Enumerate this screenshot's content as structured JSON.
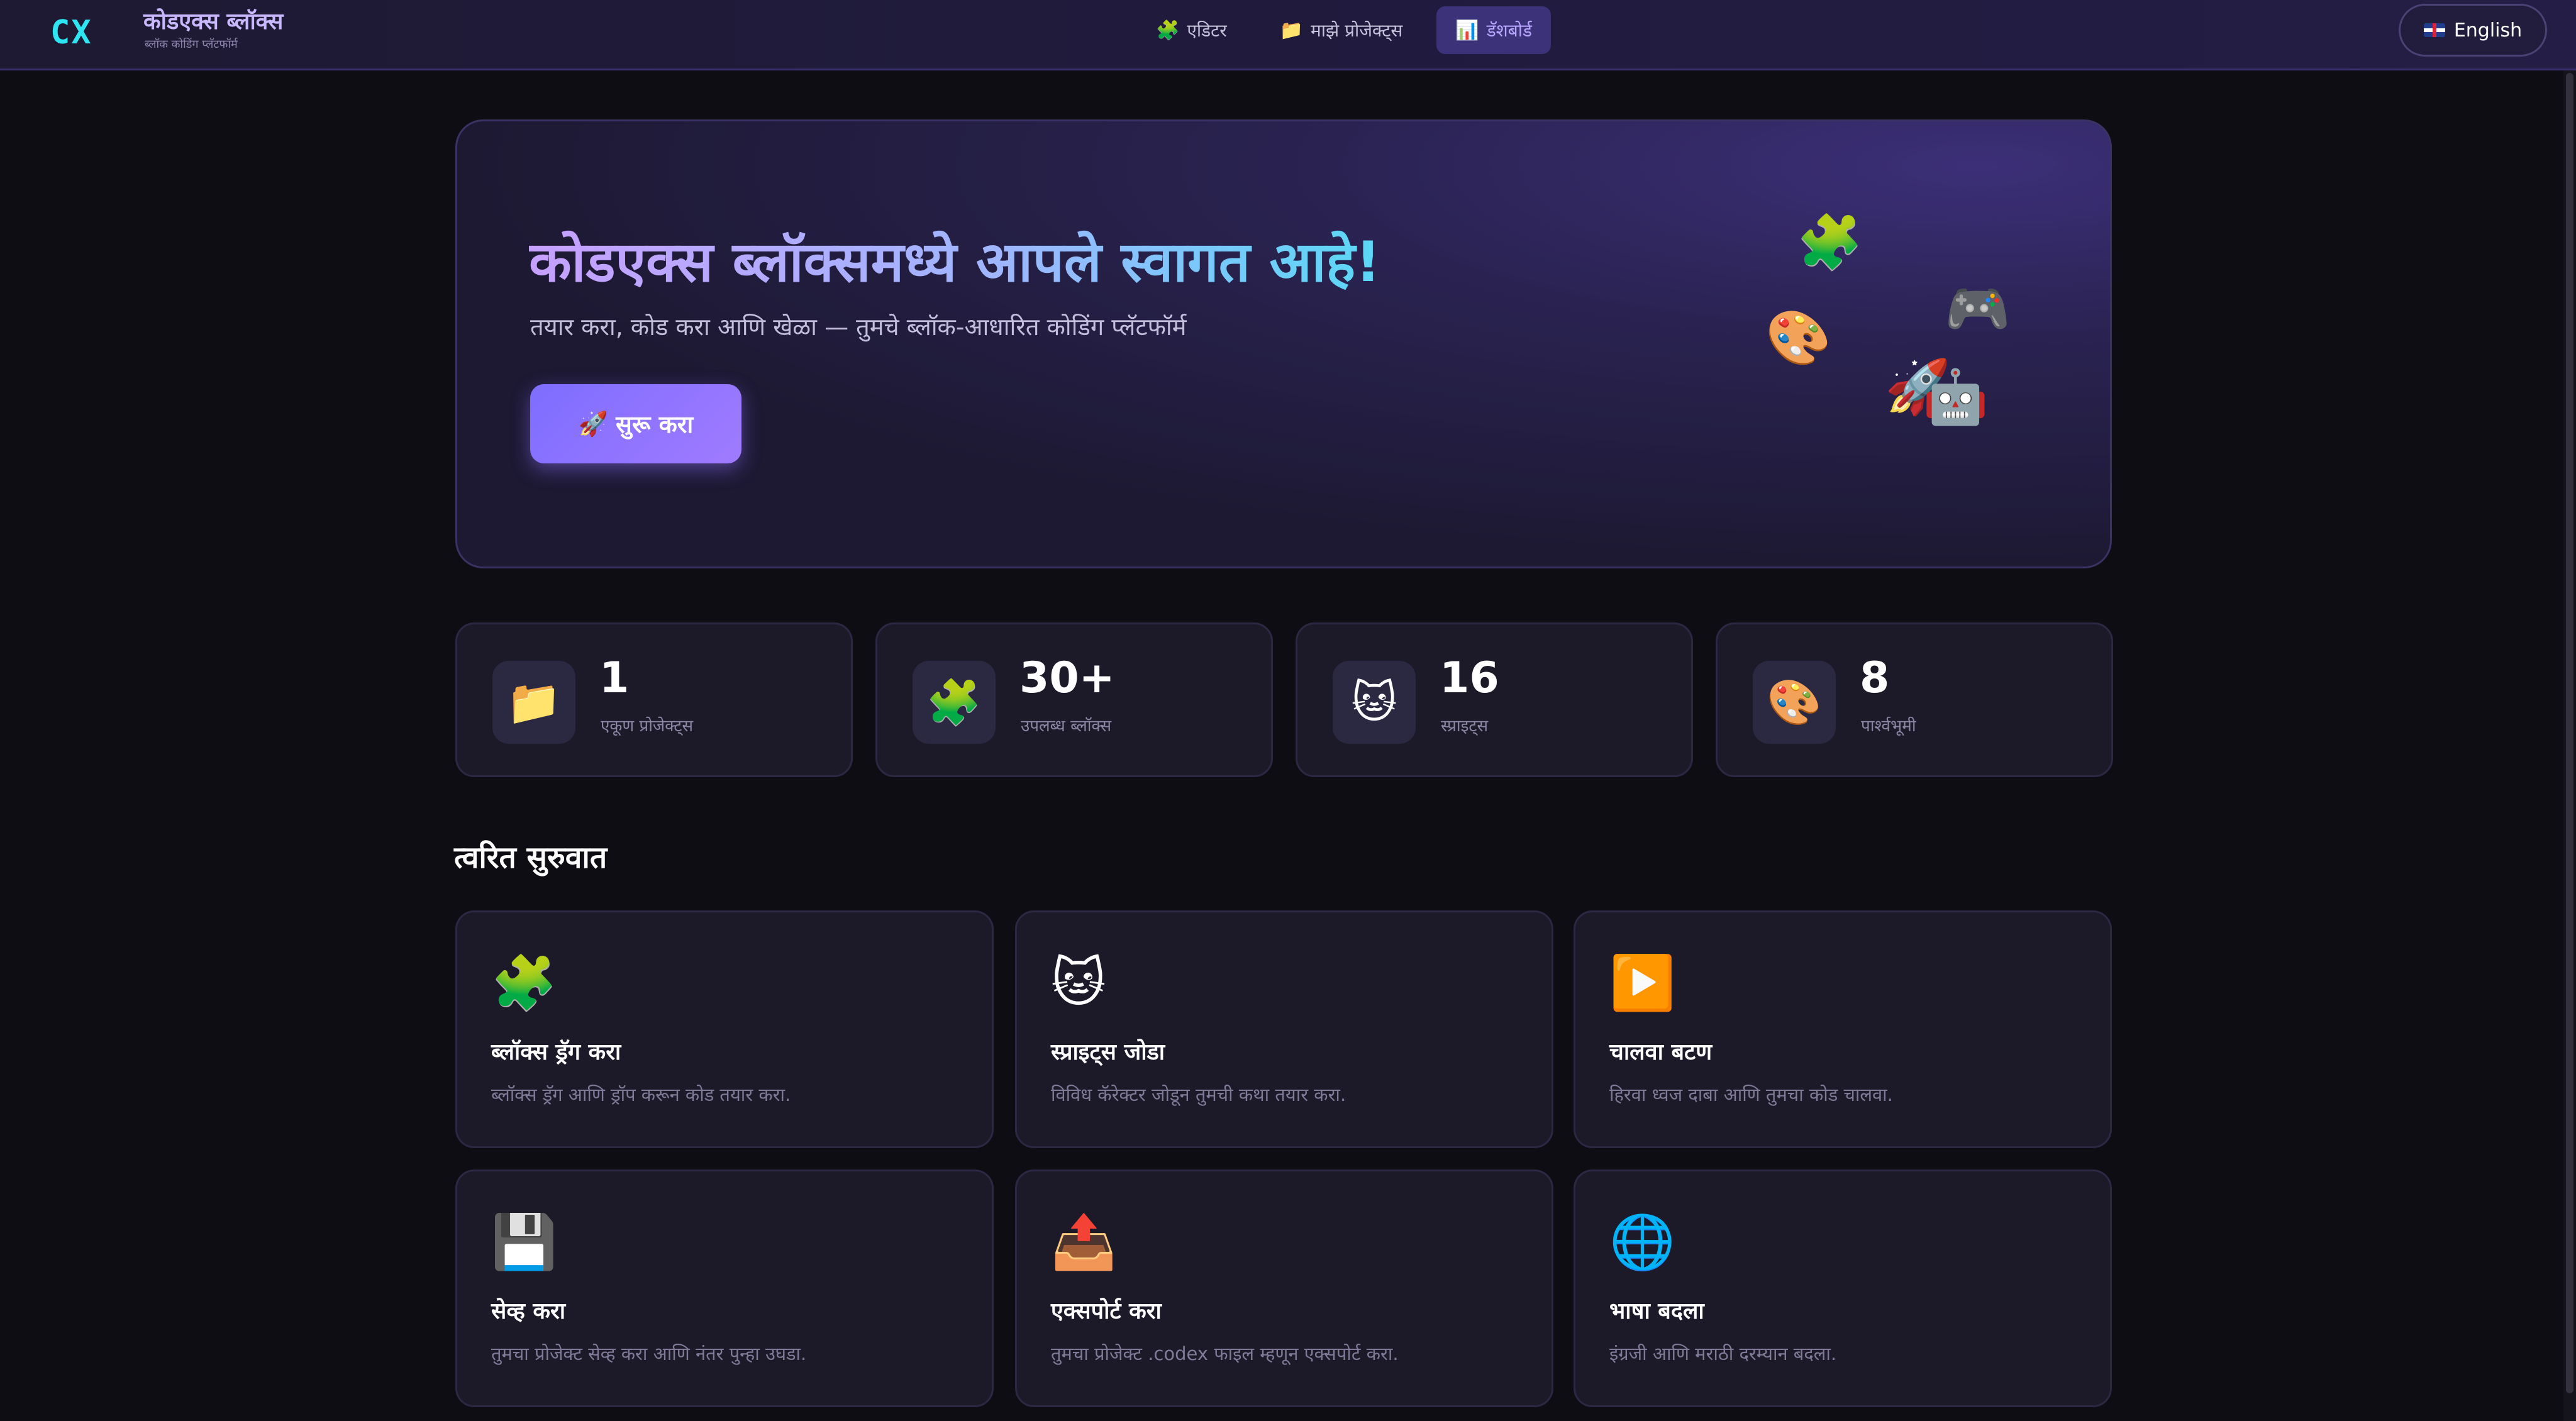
{
  "app": {
    "logo": "CX",
    "title": "कोडएक्स ब्लॉक्स",
    "subtitle": "ब्लॉक कोडिंग प्लॅटफॉर्म"
  },
  "nav": {
    "items": [
      {
        "icon": "🧩",
        "label": "एडिटर",
        "active": false
      },
      {
        "icon": "📁",
        "label": "माझे प्रोजेक्ट्स",
        "active": false
      },
      {
        "icon": "📊",
        "label": "डॅशबोर्ड",
        "active": true
      }
    ]
  },
  "language_button": {
    "label": "English",
    "flag": "uk-flag"
  },
  "hero": {
    "title": "कोडएक्स ब्लॉक्समध्ये आपले स्वागत आहे!",
    "subtitle": "तयार करा, कोड करा आणि खेळा — तुमचे ब्लॉक-आधारित कोडिंग प्लॅटफॉर्म",
    "cta_icon": "🚀",
    "cta_label": "सुरू करा",
    "decor_icons": [
      "🧩",
      "🎮",
      "🎨",
      "🚀",
      "🤖"
    ]
  },
  "stats": [
    {
      "icon": "📁",
      "value": "1",
      "label": "एकूण प्रोजेक्ट्स"
    },
    {
      "icon": "🧩",
      "value": "30+",
      "label": "उपलब्ध ब्लॉक्स"
    },
    {
      "icon": "🐱",
      "value": "16",
      "label": "स्प्राइट्स"
    },
    {
      "icon": "🎨",
      "value": "8",
      "label": "पार्श्वभूमी"
    }
  ],
  "quick_start": {
    "title": "त्वरित सुरुवात",
    "cards": [
      {
        "icon": "🧩",
        "title": "ब्लॉक्स ड्रॅग करा",
        "desc": "ब्लॉक्स ड्रॅग आणि ड्रॉप करून कोड तयार करा."
      },
      {
        "icon": "🐱",
        "title": "स्प्राइट्स जोडा",
        "desc": "विविध कॅरेक्टर जोडून तुमची कथा तयार करा."
      },
      {
        "icon": "▶️",
        "title": "चालवा बटण",
        "desc": "हिरवा ध्वज दाबा आणि तुमचा कोड चालवा."
      },
      {
        "icon": "💾",
        "title": "सेव्ह करा",
        "desc": "तुमचा प्रोजेक्ट सेव्ह करा आणि नंतर पुन्हा उघडा."
      },
      {
        "icon": "📤",
        "title": "एक्सपोर्ट करा",
        "desc": "तुमचा प्रोजेक्ट .codex फाइल म्हणून एक्सपोर्ट करा."
      },
      {
        "icon": "🌐",
        "title": "भाषा बदला",
        "desc": "इंग्रजी आणि मराठी दरम्यान बदला."
      }
    ]
  },
  "colors": {
    "background": "#0e0d13",
    "accent": "#8b78ff",
    "logo": "#2ee6f2",
    "card": "#1c1a29"
  }
}
